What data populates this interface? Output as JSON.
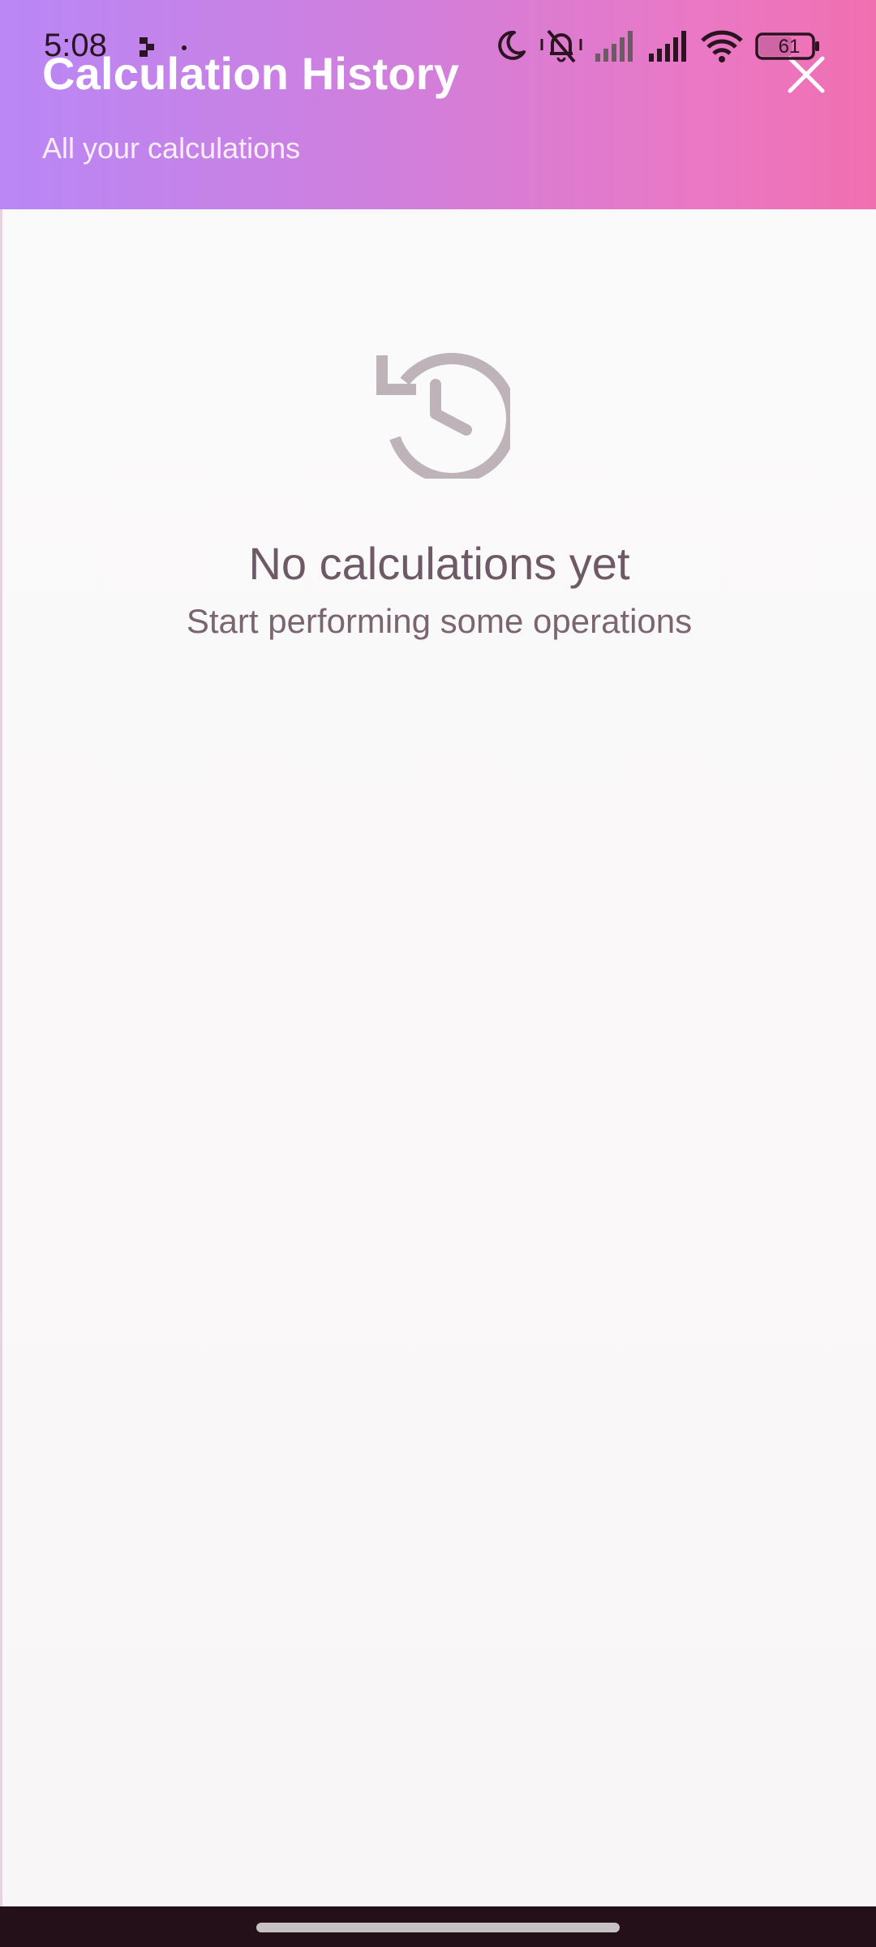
{
  "status_bar": {
    "time": "5:08",
    "battery": "61"
  },
  "header": {
    "title": "Calculation History",
    "subtitle": "All your calculations",
    "close_icon": "close-icon"
  },
  "empty_state": {
    "icon": "history-icon",
    "title": "No calculations yet",
    "subtitle": "Start performing some operations"
  },
  "colors": {
    "header_gradient_start": "#b987f6",
    "header_gradient_end": "#f06fb0",
    "empty_text": "#6e5a66",
    "icon": "#beb3b9"
  }
}
